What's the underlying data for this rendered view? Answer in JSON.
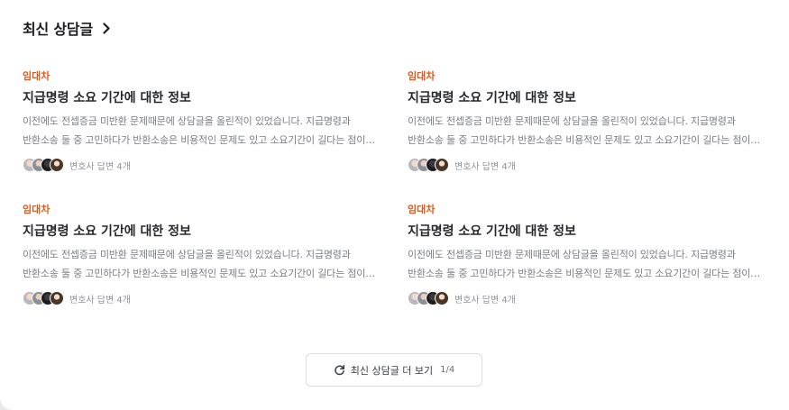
{
  "section": {
    "title": "최신 상담글"
  },
  "posts": [
    {
      "category": "임대차",
      "title": "지급명령 소요 기간에 대한 정보",
      "body": "이전에도 전셉증금 미반환 문제때문에 상담글을 올린적이 있었습니다. 지급명령과 반환소송 둘 중 고민하다가 반환소송은 비용적인 문제도 있고 소요기간이 길다는 점이 커서 고민하다가",
      "answers": "변호사 답변 4개"
    },
    {
      "category": "임대차",
      "title": "지급명령 소요 기간에 대한 정보",
      "body": "이전에도 전셉증금 미반환 문제때문에 상담글을 올린적이 있었습니다. 지급명령과 반환소송 둘 중 고민하다가 반환소송은 비용적인 문제도 있고 소요기간이 길다는 점이 커서 고민하다가",
      "answers": "변호사 답변 4개"
    },
    {
      "category": "임대차",
      "title": "지급명령 소요 기간에 대한 정보",
      "body": "이전에도 전셉증금 미반환 문제때문에 상담글을 올린적이 있었습니다. 지급명령과 반환소송 둘 중 고민하다가 반환소송은 비용적인 문제도 있고 소요기간이 길다는 점이 커서 고민하다가",
      "answers": "변호사 답변 4개"
    },
    {
      "category": "임대차",
      "title": "지급명령 소요 기간에 대한 정보",
      "body": "이전에도 전셉증금 미반환 문제때문에 상담글을 올린적이 있었습니다. 지급명령과 반환소송 둘 중 고민하다가 반환소송은 비용적인 문제도 있고 소요기간이 길다는 점이 커서 고민하다가",
      "answers": "변호사 답변 4개"
    }
  ],
  "more_button": {
    "label": "최신 상담글 더 보기",
    "page": "1/4"
  },
  "icons": {
    "header": "chevron-right-icon",
    "more": "refresh-icon"
  },
  "colors": {
    "category": "#e05a1a",
    "title": "#26282c",
    "body": "#7b7e85"
  }
}
